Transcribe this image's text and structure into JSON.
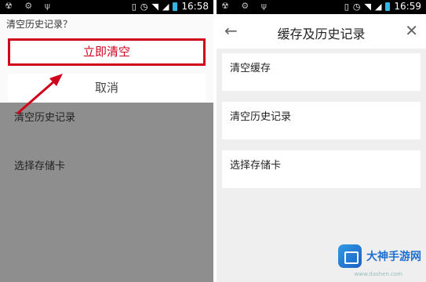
{
  "left": {
    "status": {
      "time": "16:58"
    },
    "dialog_title": "清空历史记录？",
    "confirm_label": "立即清空",
    "cancel_label": "取消",
    "items": [
      {
        "label": "清空历史记录"
      },
      {
        "label": "选择存储卡"
      }
    ]
  },
  "right": {
    "status": {
      "time": "16:59"
    },
    "title": "缓存及历史记录",
    "items": [
      {
        "label": "清空缓存"
      },
      {
        "label": "清空历史记录"
      },
      {
        "label": "选择存储卡"
      }
    ]
  },
  "watermark": {
    "name": "大神手游网",
    "url": "www.dashen.com"
  },
  "colors": {
    "accent": "#d0021b",
    "dim": "#8e8e8e",
    "brand": "#1f6fd1"
  }
}
